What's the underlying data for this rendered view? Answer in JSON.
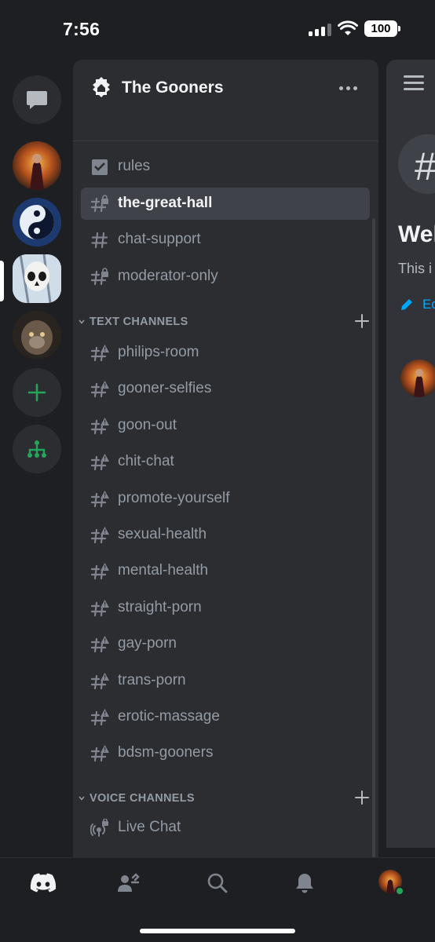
{
  "status_bar": {
    "time": "7:56",
    "battery": "100"
  },
  "server": {
    "name": "The Gooners"
  },
  "top_channels": [
    {
      "name": "rules",
      "icon": "rules-icon"
    },
    {
      "name": "the-great-hall",
      "icon": "hash-locked-icon",
      "selected": true
    },
    {
      "name": "chat-support",
      "icon": "hash-icon"
    },
    {
      "name": "moderator-only",
      "icon": "hash-locked-icon"
    }
  ],
  "text_category": {
    "label": "TEXT CHANNELS"
  },
  "text_channels": [
    "philips-room",
    "gooner-selfies",
    "goon-out",
    "chit-chat",
    "promote-yourself",
    "sexual-health",
    "mental-health",
    "straight-porn",
    "gay-porn",
    "trans-porn",
    "erotic-massage",
    "bdsm-gooners"
  ],
  "voice_category": {
    "label": "VOICE CHANNELS"
  },
  "voice_channels": [
    "Live Chat"
  ],
  "chat_panel": {
    "welcome_title": "Wel",
    "welcome_sub": "This i",
    "edit_label": "Ed"
  },
  "colors": {
    "background": "#1e1f22",
    "panel": "#2b2d31",
    "chat": "#313338",
    "selected": "#404249",
    "muted_text": "#949ba4",
    "accent_green": "#23a55a",
    "link_blue": "#00a8fc"
  }
}
